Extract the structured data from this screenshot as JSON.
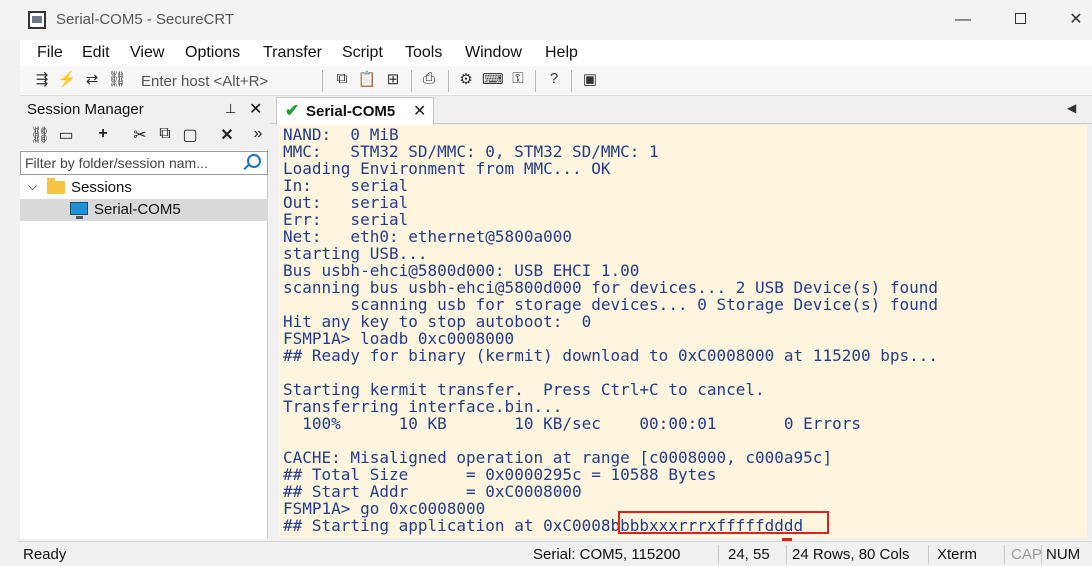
{
  "window": {
    "title": "Serial-COM5 - SecureCRT",
    "minimize": "—",
    "close": "✕"
  },
  "menu": [
    "File",
    "Edit",
    "View",
    "Options",
    "Transfer",
    "Script",
    "Tools",
    "Window",
    "Help"
  ],
  "toolbar": {
    "host_placeholder": "Enter host <Alt+R>",
    "icons": [
      "connect-icon",
      "quick-connect-icon",
      "reconnect-icon",
      "disconnect-icon",
      "copy-icon",
      "paste-icon",
      "find-icon",
      "print-icon",
      "settings-icon",
      "keymap-icon",
      "sftp-icon",
      "help-icon",
      "sessions-icon"
    ]
  },
  "session_manager": {
    "title": "Session Manager",
    "pin": "📌",
    "close": "✕",
    "filter_placeholder": "Filter by folder/session nam...",
    "tree": {
      "folder": "Sessions",
      "item": "Serial-COM5"
    }
  },
  "tab": {
    "check": "✔",
    "label": "Serial-COM5",
    "close": "✕"
  },
  "terminal": {
    "lines": [
      "NAND:  0 MiB",
      "MMC:   STM32 SD/MMC: 0, STM32 SD/MMC: 1",
      "Loading Environment from MMC... OK",
      "In:    serial",
      "Out:   serial",
      "Err:   serial",
      "Net:   eth0: ethernet@5800a000",
      "starting USB...",
      "Bus usbh-ehci@5800d000: USB EHCI 1.00",
      "scanning bus usbh-ehci@5800d000 for devices... 2 USB Device(s) found",
      "       scanning usb for storage devices... 0 Storage Device(s) found",
      "Hit any key to stop autoboot:  0",
      "FSMP1A> loadb 0xc0008000",
      "## Ready for binary (kermit) download to 0xC0008000 at 115200 bps...",
      "",
      "Starting kermit transfer.  Press Ctrl+C to cancel.",
      "Transferring interface.bin...",
      "  100%      10 KB       10 KB/sec    00:00:01       0 Errors",
      "",
      "CACHE: Misaligned operation at range [c0008000, c000a95c]",
      "## Total Size      = 0x0000295c = 10588 Bytes",
      "## Start Addr      = 0xC0008000",
      "FSMP1A> go 0xc0008000",
      "## Starting application at 0xC0008bbbbxxxrrrxfffffdddd"
    ]
  },
  "status": {
    "ready": "Ready",
    "connection": "Serial: COM5, 115200",
    "cursor": "24,  55",
    "size": "24 Rows, 80 Cols",
    "terminal_type": "Xterm",
    "cap": "CAP",
    "num": "NUM"
  },
  "colors": {
    "terminal_bg": "#fdf5dd",
    "terminal_text": "#243c8c",
    "highlight": "#e02020",
    "tab_check": "#1aa33a"
  }
}
